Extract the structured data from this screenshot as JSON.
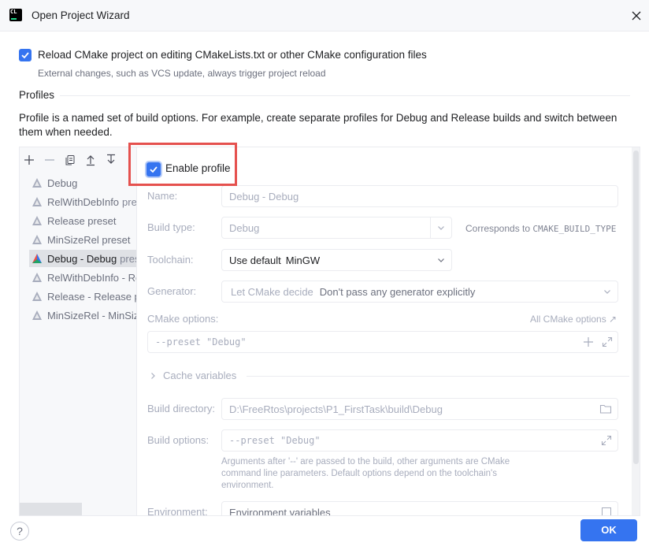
{
  "window": {
    "title": "Open Project Wizard",
    "app_icon_text": "CL"
  },
  "reload": {
    "checked": true,
    "label": "Reload CMake project on editing CMakeLists.txt or other CMake configuration files",
    "hint": "External changes, such as VCS update, always trigger project reload"
  },
  "profiles": {
    "title": "Profiles",
    "description": "Profile is a named set of build options. For example, create separate profiles for Debug and Release builds and switch between them when needed.",
    "toolbar": [
      "add-icon",
      "remove-icon",
      "copy-icon",
      "move-up-icon",
      "move-down-icon"
    ],
    "items": [
      {
        "name": "Debug",
        "suffix": "",
        "selected": false
      },
      {
        "name": "RelWithDebInfo",
        "suffix": "pres",
        "selected": false
      },
      {
        "name": "Release preset",
        "suffix": "",
        "selected": false
      },
      {
        "name": "MinSizeRel preset",
        "suffix": "",
        "selected": false
      },
      {
        "name": "Debug - Debug",
        "suffix": "pres",
        "selected": true
      },
      {
        "name": "RelWithDebInfo - Re",
        "suffix": "",
        "selected": false
      },
      {
        "name": "Release - Release p",
        "suffix": "",
        "selected": false
      },
      {
        "name": "MinSizeRel - MinSiz",
        "suffix": "",
        "selected": false
      }
    ]
  },
  "form": {
    "enable_profile": {
      "label": "Enable profile",
      "checked": true
    },
    "name": {
      "label": "Name:",
      "value": "Debug - Debug"
    },
    "build_type": {
      "label": "Build type:",
      "value": "Debug",
      "note_prefix": "Corresponds to ",
      "note_code": "CMAKE_BUILD_TYPE"
    },
    "toolchain": {
      "label": "Toolchain:",
      "prefix": "Use default",
      "value": "MinGW"
    },
    "generator": {
      "label": "Generator:",
      "prefix": "Let CMake decide",
      "value": "Don't pass any generator explicitly"
    },
    "cmake_options": {
      "label": "CMake options:",
      "link": "All CMake options ↗",
      "value": "--preset \"Debug\""
    },
    "cache_variables": {
      "label": "Cache variables"
    },
    "build_directory": {
      "label": "Build directory:",
      "value": "D:\\FreeRtos\\projects\\P1_FirstTask\\build\\Debug"
    },
    "build_options": {
      "label": "Build options:",
      "value": "--preset \"Debug\"",
      "help": [
        "Arguments after '--' are passed to the build, other arguments are CMake",
        "command line parameters. Default options depend on the toolchain's",
        "environment."
      ]
    },
    "environment": {
      "label": "Environment:",
      "value": "Environment variables"
    }
  },
  "footer": {
    "help": "?",
    "ok": "OK"
  },
  "colors": {
    "accent": "#3574f0",
    "highlight": "#e5514e"
  }
}
